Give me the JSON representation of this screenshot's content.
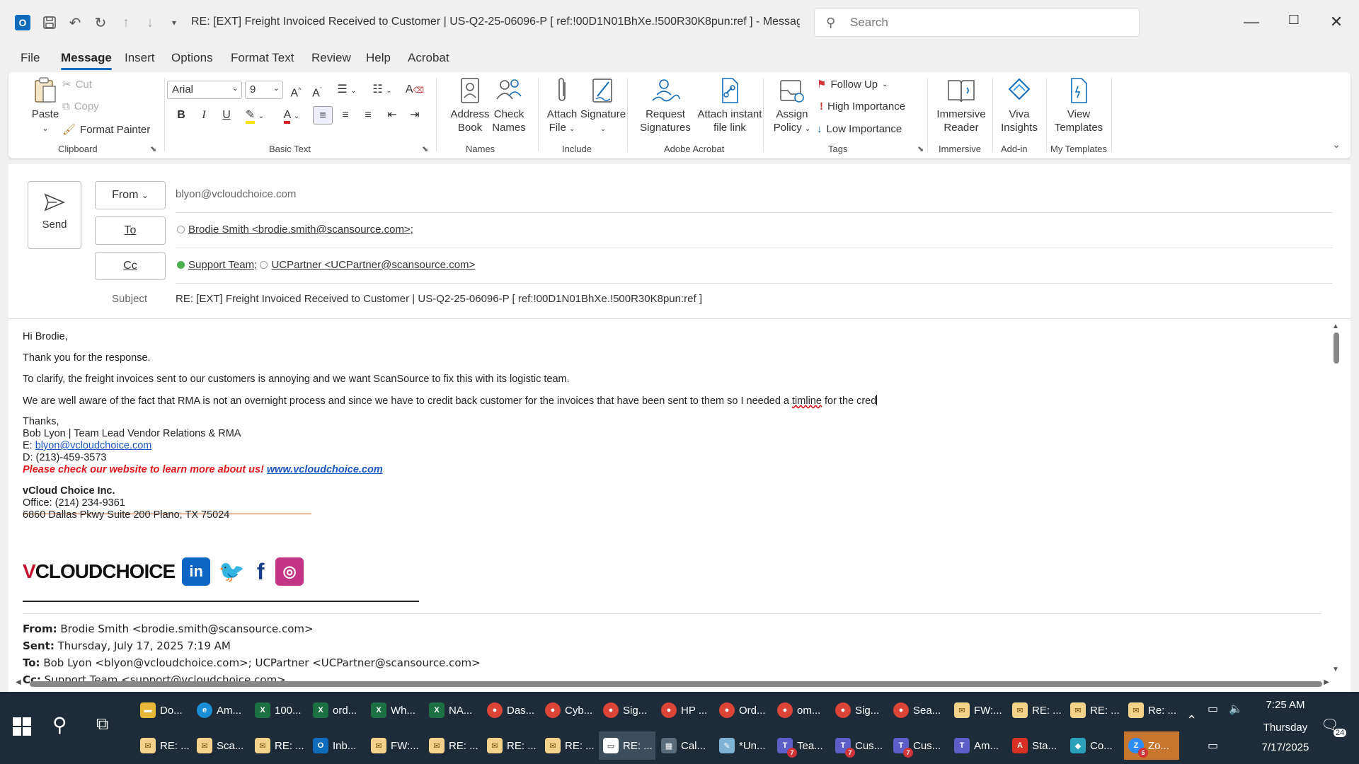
{
  "window": {
    "title": "RE: [EXT] Freight Invoiced Received to Customer | US-Q2-25-06096-P    [ ref:!00D1N01BhXe.!500R30K8pun:ref ]  -  Message (HT...",
    "search_placeholder": "Search"
  },
  "menu": {
    "tabs": [
      "File",
      "Message",
      "Insert",
      "Options",
      "Format Text",
      "Review",
      "Help",
      "Acrobat"
    ]
  },
  "ribbon": {
    "clipboard": {
      "paste": "Paste",
      "cut": "Cut",
      "copy": "Copy",
      "format_painter": "Format Painter",
      "label": "Clipboard"
    },
    "basic_text": {
      "font": "Arial",
      "size": "9",
      "label": "Basic Text"
    },
    "names": {
      "address_book_1": "Address",
      "address_book_2": "Book",
      "check_names_1": "Check",
      "check_names_2": "Names",
      "label": "Names"
    },
    "include": {
      "attach_1": "Attach",
      "attach_2": "File",
      "signature": "Signature",
      "label": "Include"
    },
    "adobe": {
      "request_1": "Request",
      "request_2": "Signatures",
      "attach_link_1": "Attach instant",
      "attach_link_2": "file link",
      "label": "Adobe Acrobat"
    },
    "tags": {
      "assign_1": "Assign",
      "assign_2": "Policy",
      "follow_up": "Follow Up",
      "high": "High Importance",
      "low": "Low Importance",
      "label": "Tags"
    },
    "immersive": {
      "btn_1": "Immersive",
      "btn_2": "Reader",
      "label": "Immersive"
    },
    "addin": {
      "btn_1": "Viva",
      "btn_2": "Insights",
      "label": "Add-in"
    },
    "templates": {
      "btn_1": "View",
      "btn_2": "Templates",
      "label": "My Templates"
    }
  },
  "compose": {
    "send": "Send",
    "from_label": "From",
    "from_value": "blyon@vcloudchoice.com",
    "to_label": "To",
    "to_recipient": "Brodie Smith <brodie.smith@scansource.com>;",
    "cc_label": "Cc",
    "cc_recipient_1": "Support Team;",
    "cc_recipient_2": "UCPartner <UCPartner@scansource.com>",
    "subject_label": "Subject",
    "subject_value": "RE: [EXT] Freight Invoiced Received to Customer | US-Q2-25-06096-P    [ ref:!00D1N01BhXe.!500R30K8pun:ref ]"
  },
  "body": {
    "greeting": "Hi Brodie,",
    "line1": "Thank you for the response.",
    "line2": "To clarify, the freight invoices sent to our customers is annoying and we want ScanSource to fix this with its logistic team.",
    "line3_a": "We are well aware of the fact that RMA is not an overnight process and since we have to credit back customer for the invoices that have been sent to them so I needed a ",
    "line3_b": "timline",
    "line3_c": " for the cred",
    "thanks": "Thanks,",
    "sig_name": "Bob Lyon | Team Lead Vendor Relations & RMA",
    "sig_email_label": "E: ",
    "sig_email": "blyon@vcloudchoice.com",
    "sig_phone": "D: (213)-459-3573",
    "sig_promo": "Please check our website to learn more about us! ",
    "sig_site": "www.vcloudchoice.com",
    "company": "vCloud Choice Inc.",
    "office": "Office: (214) 234-9361",
    "address": "6860 Dallas Pkwy Suite 200 Plano, TX 75024",
    "logo_v": "V",
    "logo_text": "CLOUDCHOICE",
    "quote_from_label": "From:",
    "quote_from": " Brodie Smith <brodie.smith@scansource.com>",
    "quote_sent_label": "Sent:",
    "quote_sent": " Thursday, July 17, 2025 7:19 AM",
    "quote_to_label": "To:",
    "quote_to": " Bob Lyon <blyon@vcloudchoice.com>; UCPartner <UCPartner@scansource.com>",
    "quote_cc_label": "Cc:",
    "quote_cc": " Support Team <support@vcloudchoice.com>"
  },
  "taskbar": {
    "row1": [
      "Do...",
      "Am...",
      "100...",
      "ord...",
      "Wh...",
      "NA...",
      "Das...",
      "Cyb...",
      "Sig...",
      "HP ...",
      "Ord...",
      "om...",
      "Sig...",
      "Sea...",
      "FW:...",
      "RE: ...",
      "RE: ...",
      "Re: ..."
    ],
    "row2": [
      "RE: ...",
      "Sca...",
      "RE: ...",
      "Inb...",
      "FW:...",
      "RE: ...",
      "RE: ...",
      "RE: ...",
      "RE: ...",
      "Cal...",
      "*Un...",
      "Tea...",
      "Cus...",
      "Cus...",
      "Am...",
      "Sta...",
      "Co...",
      "Zo..."
    ],
    "time": "7:25 AM",
    "day": "Thursday",
    "date": "7/17/2025",
    "notif_count": "24",
    "badges": {
      "teams": "7",
      "zoom": "6"
    }
  },
  "colors": {
    "accent": "#0f6cbd",
    "taskbar": "#1e2b38",
    "promo_red": "#e0161b",
    "link": "#1a56c4"
  }
}
